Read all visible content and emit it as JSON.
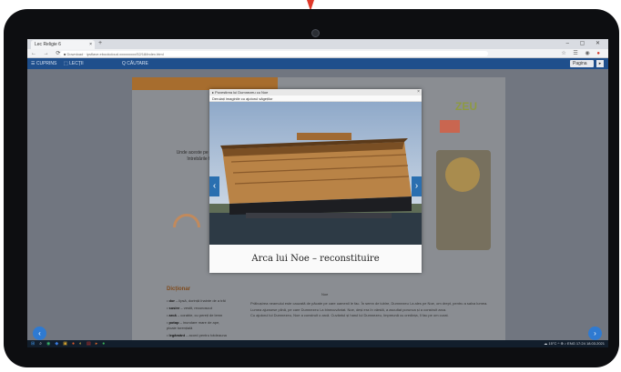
{
  "browser": {
    "tab_title": "Lec Religie 6",
    "tab_close": "×",
    "new_tab": "+",
    "window_controls": "– ▢ ✕",
    "nav_buttons": "← → ⟳",
    "url": "■ Download · ipsflave.ebookcloud.xxxxxxxxx/52/18/index.html",
    "ext_icons": "☆ ☰ ◉",
    "ext_red": "●"
  },
  "app_toolbar": {
    "items": [
      "☰ CUPRINS",
      "⬚ LECȚII",
      "Q CĂUTARE"
    ],
    "page_field": "Pagina",
    "go": "▸"
  },
  "page": {
    "bg_title": "ZEU",
    "side_text": "Unde aceste pe înțele alegi întrebările făcute",
    "dictionary_title": "Dicționar",
    "dictionary": [
      {
        "term": "dor",
        "def": " – lipsă, dorință înainte de a trăi"
      },
      {
        "term": "sosire",
        "def": " – vestit, recunoscut"
      },
      {
        "term": "arcă",
        "def": " – corabie, cu pereți de lemn"
      },
      {
        "term": "potop",
        "def": " – inundare mare de ape, ploaie torențială"
      },
      {
        "term": "legământ",
        "def": " – acord pentru totdeauna"
      }
    ],
    "caption_bg": "Noe",
    "body_paragraphs": [
      "Prăbușirea neamului este cauzată de păcate pe care oamenii le fac. În semn de iubire, Dumnezeu l-a ales pe Noe, om drept, pentru a salva lumea.",
      "Lumea ajunsese plină, pe care Dumnezeu l-a binecuvântat. Noe, deși era în vârstă, a ascultat porunca și a construit arca.",
      "Cu ajutorul lui Dumnezeu, Noe a construit o arcă. Cuvântul și harul lui Dumnezeu, împreună cu credința, îl fac pe om curat."
    ]
  },
  "modal": {
    "title": "▸ Povestirea lui Dumnezeu cu Noe",
    "close": "×",
    "subtitle": "Derulați imaginile cu ajutorul săgeților",
    "caption": "Arca lui Noe – reconstituire",
    "prev": "‹",
    "next": "›"
  },
  "page_nav": {
    "prev": "‹",
    "next": "›"
  },
  "taskbar": {
    "icons": [
      {
        "glyph": "⊞",
        "color": "#3d8fe0"
      },
      {
        "glyph": "⌕",
        "color": "#cfd6df"
      },
      {
        "glyph": "◉",
        "color": "#39b46a"
      },
      {
        "glyph": "◆",
        "color": "#3a7be0"
      },
      {
        "glyph": "▣",
        "color": "#d8a52f"
      },
      {
        "glyph": "●",
        "color": "#e25a2c"
      },
      {
        "glyph": "◐",
        "color": "#e0c14a"
      },
      {
        "glyph": "▤",
        "color": "#c9312b"
      },
      {
        "glyph": "▸",
        "color": "#e06b2c"
      },
      {
        "glyph": "●",
        "color": "#3bb356"
      }
    ],
    "weather": "☁ 15°C",
    "tray": "^ ⊕ ♪ ENG",
    "time": "17:24",
    "date": "18.03.2021"
  },
  "colors": {
    "accent_blue": "#2f7ad1",
    "toolbar_blue": "#1f4f8c",
    "orange": "#a76d2e"
  }
}
